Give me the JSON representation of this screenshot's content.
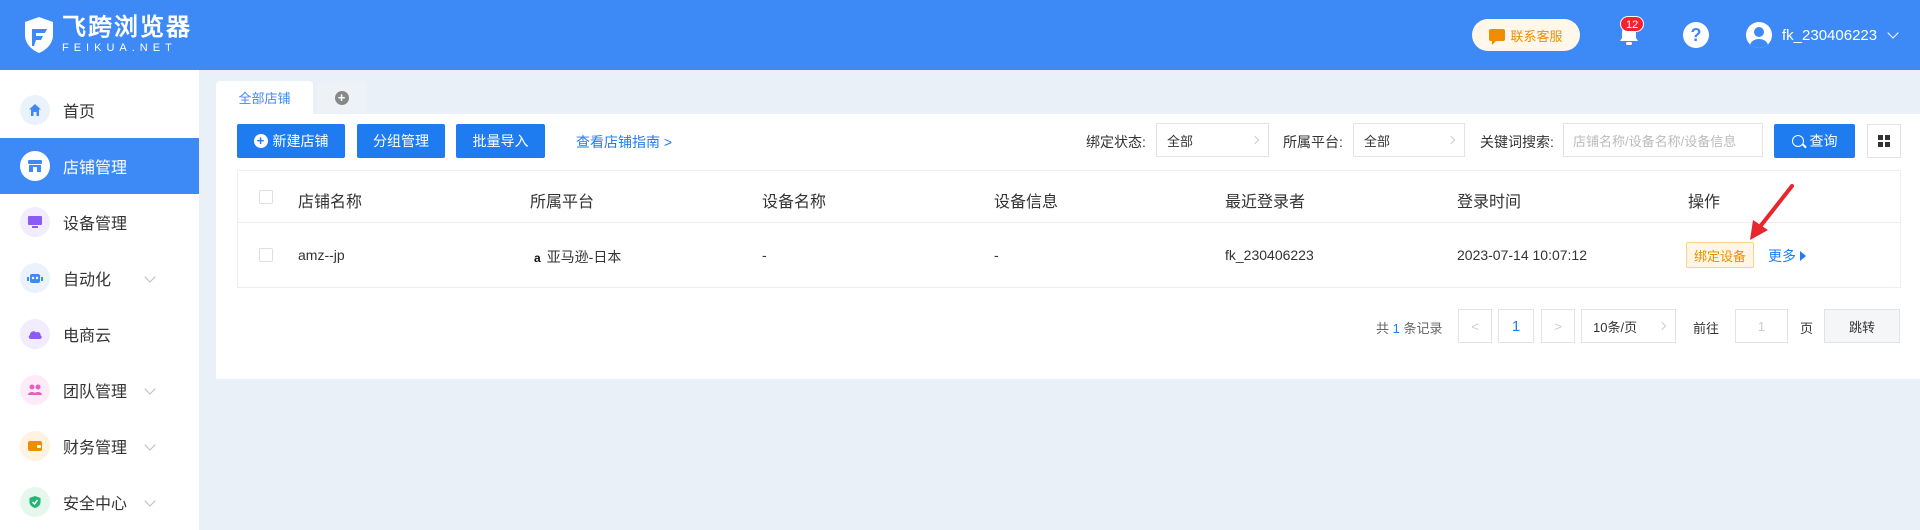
{
  "header": {
    "logo_title": "飞跨浏览器",
    "logo_sub": "FEIKUA.NET",
    "support_label": "联系客服",
    "notification_count": "12",
    "help_symbol": "?",
    "username": "fk_230406223",
    "brand_color": "#3d8af7"
  },
  "sidebar": {
    "items": [
      {
        "label": "首页",
        "icon": "home-icon",
        "color": "#3d8af7",
        "bg": "#eaf2fe"
      },
      {
        "label": "店铺管理",
        "icon": "store-icon",
        "color": "#3d8af7",
        "bg": "#ffffff"
      },
      {
        "label": "设备管理",
        "icon": "device-icon",
        "color": "#8a5cf5",
        "bg": "#f1ecfe"
      },
      {
        "label": "自动化",
        "icon": "robot-icon",
        "color": "#3d8af7",
        "bg": "#eaf2fe"
      },
      {
        "label": "电商云",
        "icon": "cloud-icon",
        "color": "#8a5cf5",
        "bg": "#f1ecfe"
      },
      {
        "label": "团队管理",
        "icon": "team-icon",
        "color": "#e85ec4",
        "bg": "#fdebf7"
      },
      {
        "label": "财务管理",
        "icon": "wallet-icon",
        "color": "#f08c00",
        "bg": "#fff2e0"
      },
      {
        "label": "安全中心",
        "icon": "shield-icon",
        "color": "#22b573",
        "bg": "#e6f7ee"
      }
    ]
  },
  "tabs": {
    "all_stores": "全部店铺",
    "add_symbol": "+"
  },
  "toolbar": {
    "new_store": "新建店铺",
    "group_manage": "分组管理",
    "batch_import": "批量导入",
    "guide_link": "查看店铺指南 >",
    "bind_status_label": "绑定状态:",
    "bind_status_value": "全部",
    "platform_label": "所属平台:",
    "platform_value": "全部",
    "keyword_label": "关键词搜索:",
    "keyword_placeholder": "店铺名称/设备名称/设备信息",
    "query": "查询"
  },
  "table": {
    "columns": [
      "店铺名称",
      "所属平台",
      "设备名称",
      "设备信息",
      "最近登录者",
      "登录时间",
      "操作"
    ],
    "rows": [
      {
        "store_name": "amz--jp",
        "platform_icon": "a",
        "platform": "亚马逊-日本",
        "device_name": "-",
        "device_info": "-",
        "last_login_user": "fk_230406223",
        "login_time": "2023-07-14 10:07:12",
        "bind_device": "绑定设备",
        "more": "更多"
      }
    ]
  },
  "pagination": {
    "total_prefix": "共",
    "total": "1",
    "total_suffix": "条记录",
    "prev": "<",
    "current": "1",
    "next": ">",
    "page_size": "10条/页",
    "goto_label": "前往",
    "goto_value": "1",
    "page_unit": "页",
    "jump": "跳转"
  }
}
